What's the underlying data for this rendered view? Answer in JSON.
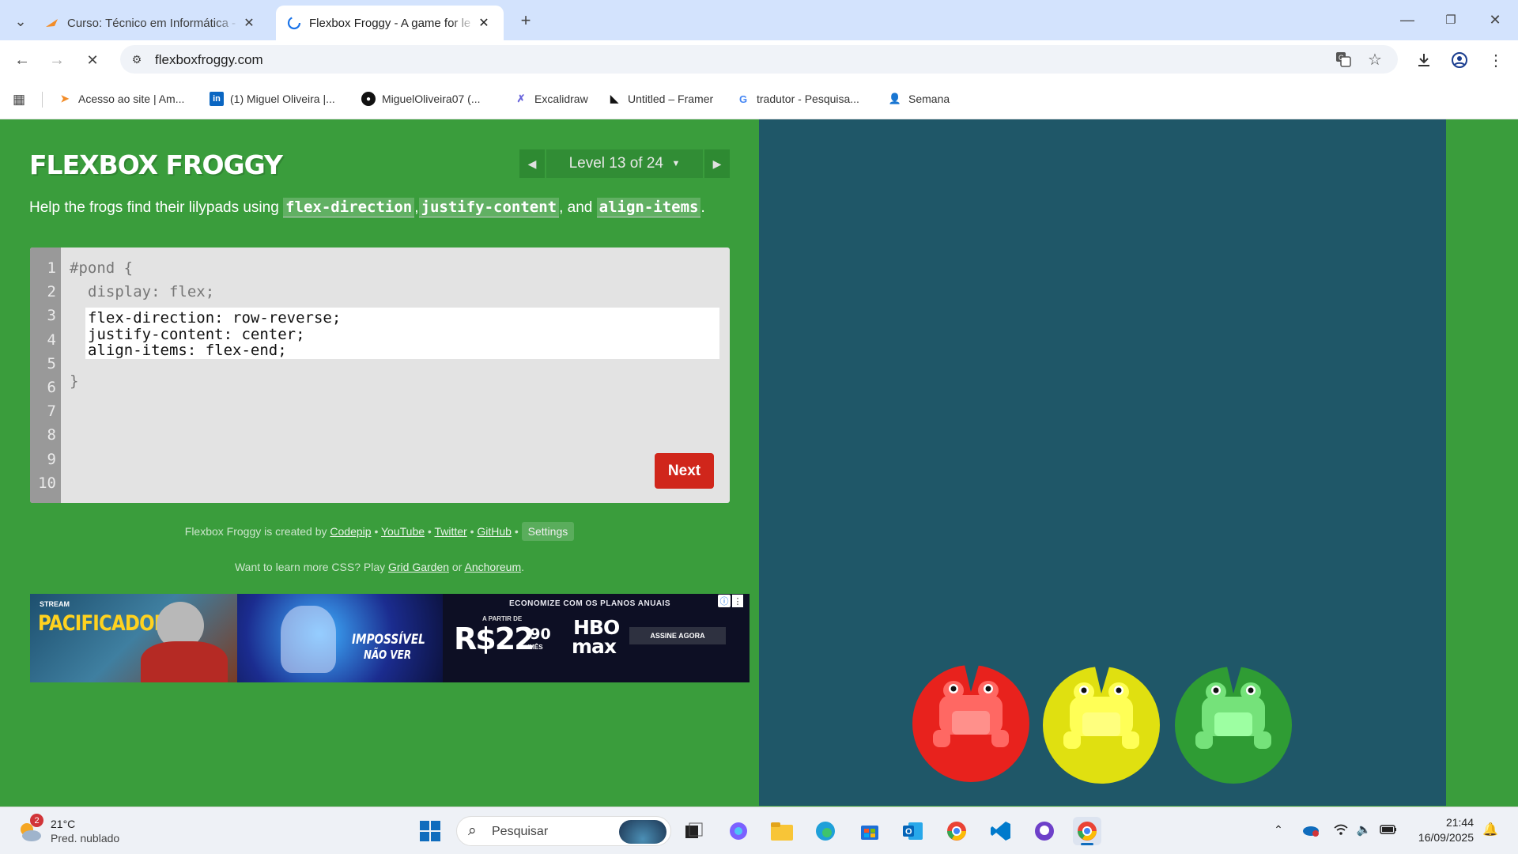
{
  "browser": {
    "tabs": [
      {
        "title": "Curso: Técnico em Informática -",
        "active": false
      },
      {
        "title": "Flexbox Froggy - A game for le",
        "active": true
      }
    ],
    "url": "flexboxfroggy.com",
    "bookmarks": [
      "Acesso ao site | Am...",
      "(1) Miguel Oliveira |...",
      "MiguelOliveira07 (...",
      "Excalidraw",
      "Untitled – Framer",
      "tradutor - Pesquisa...",
      "Semana"
    ]
  },
  "game": {
    "logo": "FLEXBOX FROGGY",
    "level_label": "Level 13 of 24",
    "instructions_prefix": "Help the frogs find their lilypads using ",
    "kw1": "flex-direction",
    "sep1": ",",
    "kw2": "justify-content",
    "sep2": ", and ",
    "kw3": "align-items",
    "sep3": ".",
    "line_numbers": "1\n2\n3\n4\n5\n6\n7\n8\n9\n10",
    "code_line1": "#pond {",
    "code_line2": "display: flex;",
    "input_lines": [
      "flex-direction: row-reverse;",
      "justify-content: center;",
      "align-items: flex-end;"
    ],
    "code_line6": "}",
    "next_label": "Next",
    "credits": {
      "prefix": "Flexbox Froggy is created by ",
      "codepip": "Codepip",
      "youtube": "YouTube",
      "twitter": "Twitter",
      "github": "GitHub",
      "bullet": " • ",
      "settings": "Settings"
    },
    "learn": {
      "prefix": "Want to learn more CSS? Play ",
      "grid": "Grid Garden",
      "or": " or ",
      "anchoreum": "Anchoreum",
      "suffix": "."
    },
    "frog_colors": [
      "#e8221d",
      "#e0e010",
      "#2f9c34"
    ]
  },
  "ad": {
    "panel1_badge": "STREAM",
    "panel1_title": "PACIFICADOR",
    "panel2_line1": "IMPOSSÍVEL",
    "panel2_line2": "NÃO VER",
    "panel3_top": "ECONOMIZE COM OS PLANOS ANUAIS",
    "panel3_from": "A PARTIR DE",
    "panel3_price": "R$22",
    "panel3_cents": ",90",
    "panel3_per": "/MÊS",
    "panel3_brand1": "HBO",
    "panel3_brand2": "max",
    "panel3_cta": "ASSINE AGORA"
  },
  "taskbar": {
    "weather_temp": "21°C",
    "weather_desc": "Pred. nublado",
    "weather_badge": "2",
    "search_placeholder": "Pesquisar",
    "time": "21:44",
    "date": "16/09/2025"
  }
}
